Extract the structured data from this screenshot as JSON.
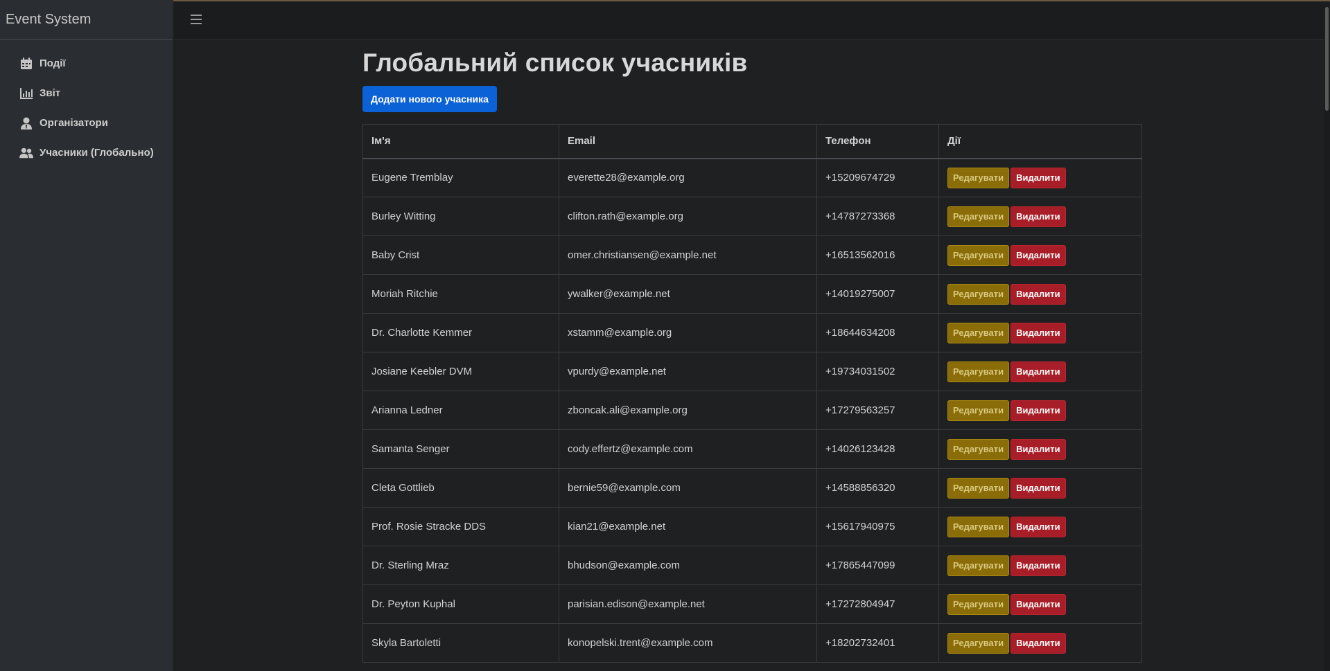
{
  "app": {
    "brand": "Event System"
  },
  "sidebar": {
    "items": [
      {
        "label": "Події",
        "icon": "calendar-icon"
      },
      {
        "label": "Звіт",
        "icon": "chart-icon"
      },
      {
        "label": "Організатори",
        "icon": "user-tie-icon"
      },
      {
        "label": "Учасники (Глобально)",
        "icon": "users-icon"
      }
    ]
  },
  "page": {
    "title": "Глобальний список учасників",
    "add_button": "Додати нового учасника"
  },
  "table": {
    "headers": {
      "name": "Ім'я",
      "email": "Email",
      "phone": "Телефон",
      "actions": "Дії"
    },
    "edit_label": "Редагувати",
    "delete_label": "Видалити",
    "rows": [
      {
        "name": "Eugene Tremblay",
        "email": "everette28@example.org",
        "phone": "+15209674729"
      },
      {
        "name": "Burley Witting",
        "email": "clifton.rath@example.org",
        "phone": "+14787273368"
      },
      {
        "name": "Baby Crist",
        "email": "omer.christiansen@example.net",
        "phone": "+16513562016"
      },
      {
        "name": "Moriah Ritchie",
        "email": "ywalker@example.net",
        "phone": "+14019275007"
      },
      {
        "name": "Dr. Charlotte Kemmer",
        "email": "xstamm@example.org",
        "phone": "+18644634208"
      },
      {
        "name": "Josiane Keebler DVM",
        "email": "vpurdy@example.net",
        "phone": "+19734031502"
      },
      {
        "name": "Arianna Ledner",
        "email": "zboncak.ali@example.org",
        "phone": "+17279563257"
      },
      {
        "name": "Samanta Senger",
        "email": "cody.effertz@example.com",
        "phone": "+14026123428"
      },
      {
        "name": "Cleta Gottlieb",
        "email": "bernie59@example.com",
        "phone": "+14588856320"
      },
      {
        "name": "Prof. Rosie Stracke DDS",
        "email": "kian21@example.net",
        "phone": "+15617940975"
      },
      {
        "name": "Dr. Sterling Mraz",
        "email": "bhudson@example.com",
        "phone": "+17865447099"
      },
      {
        "name": "Dr. Peyton Kuphal",
        "email": "parisian.edison@example.net",
        "phone": "+17272804947"
      },
      {
        "name": "Skyla Bartoletti",
        "email": "konopelski.trent@example.com",
        "phone": "+18202732401"
      }
    ]
  }
}
